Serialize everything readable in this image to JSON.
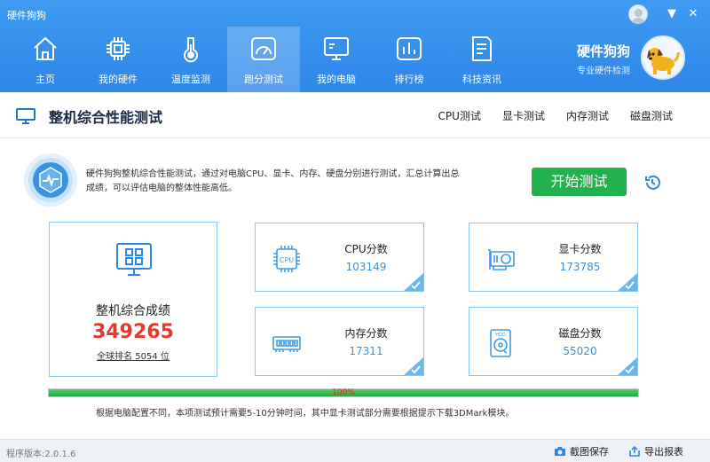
{
  "app": {
    "title": "硬件狗狗"
  },
  "window": {
    "minimize": "▼",
    "close": "✕"
  },
  "nav": {
    "items": [
      {
        "label": "主页",
        "icon": "home-icon"
      },
      {
        "label": "我的硬件",
        "icon": "chip-icon"
      },
      {
        "label": "温度监测",
        "icon": "thermometer-icon"
      },
      {
        "label": "跑分测试",
        "icon": "gauge-icon",
        "active": true
      },
      {
        "label": "我的电脑",
        "icon": "computer-icon"
      },
      {
        "label": "排行榜",
        "icon": "bar-chart-icon"
      },
      {
        "label": "科技资讯",
        "icon": "news-icon"
      }
    ]
  },
  "brand": {
    "name": "硬件狗狗",
    "tagline": "专业硬件检测"
  },
  "page": {
    "title": "整机综合性能测试",
    "tabs": [
      "CPU测试",
      "显卡测试",
      "内存测试",
      "磁盘测试"
    ]
  },
  "intro": {
    "line1": "硬件狗狗整机综合性能测试，通过对电脑CPU、显卡、内存、硬盘分别进行测试，汇总计算出总",
    "line2": "成绩，可以评估电脑的整体性能高低。",
    "start_label": "开始测试"
  },
  "total": {
    "label": "整机综合成绩",
    "score": "349265",
    "rank_prefix": "全球排名",
    "rank": "5054",
    "rank_suffix": "位"
  },
  "scores": {
    "cpu": {
      "label": "CPU分数",
      "value": "103149",
      "chip_text": "CPU"
    },
    "gpu": {
      "label": "显卡分数",
      "value": "173785"
    },
    "memory": {
      "label": "内存分数",
      "value": "17311"
    },
    "disk": {
      "label": "磁盘分数",
      "value": "55020",
      "disk_text": "HDD"
    }
  },
  "progress": {
    "percent_text": "100%",
    "value": 100
  },
  "note": "根据电脑配置不同，本项测试预计需要5-10分钟时间，其中显卡测试部分需要根据提示下载3DMark模块。",
  "footer": {
    "version": "程序版本:2.0.1.6",
    "screenshot_label": "截图保存",
    "export_label": "导出报表"
  },
  "colors": {
    "accent": "#2e86e8",
    "start": "#22b14c",
    "score": "#e23a2e",
    "value": "#3d8fd8"
  }
}
